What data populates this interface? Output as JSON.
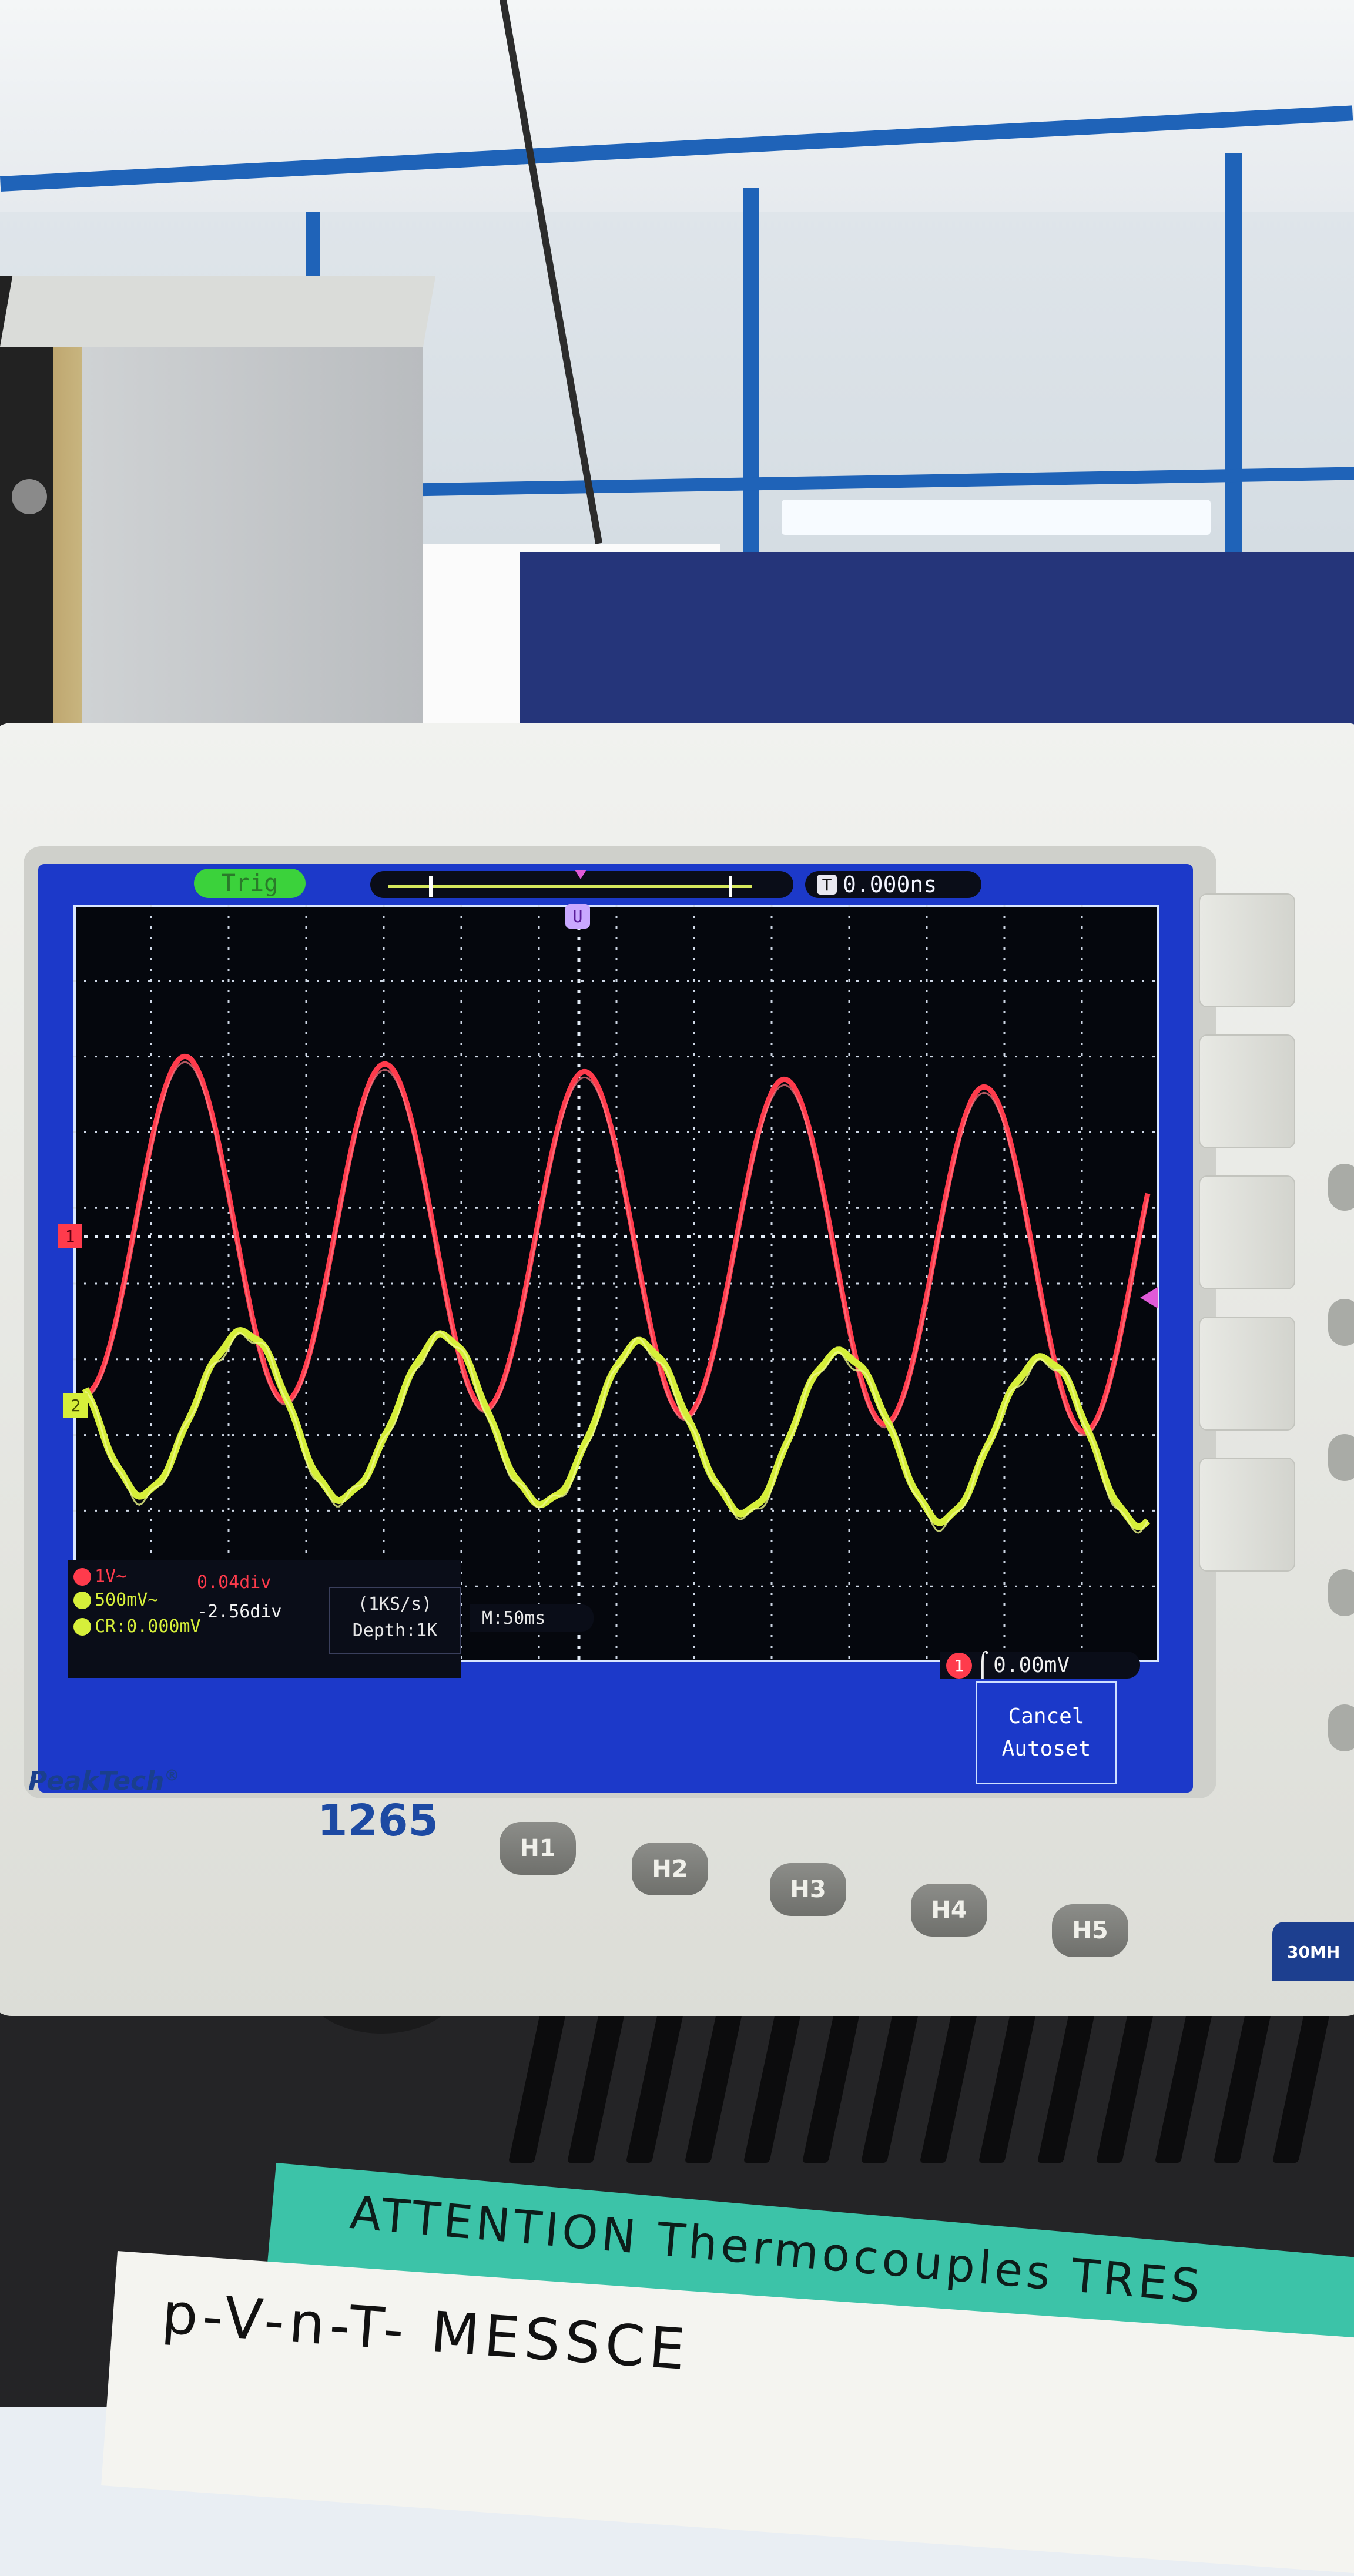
{
  "scope": {
    "brand": "PeakTech",
    "brand_mark": "®",
    "model": "1265",
    "spec_badge": "30MH",
    "trigger_status": "Trig",
    "trigger_time": "0.000ns",
    "trigger_time_icon": "T",
    "ch1_marker": "1",
    "ch2_marker": "2",
    "trigger_marker": "U",
    "ch1_scale": "1V~",
    "ch1_offset": "0.04div",
    "ch2_scale": "500mV~",
    "ch2_offset": "-2.56div",
    "cursor_readout": "CR:0.000mV",
    "sample_rate": "(1KS/s)",
    "depth": "Depth:1K",
    "timebase": "M:50ms",
    "trigger_level": "0.00mV",
    "trigger_level_icon": "1",
    "softkey_line1": "Cancel",
    "softkey_line2": "Autoset",
    "buttons": [
      "H1",
      "H2",
      "H3",
      "H4",
      "H5"
    ]
  },
  "label": {
    "warning": "ATTENTION Thermocouples TRES",
    "device": "p-V-n-T- MESSCE"
  },
  "colors": {
    "screen_blue": "#1c39c9",
    "ch1": "#ff3b4c",
    "ch2": "#d6ef3a",
    "grid": "#cfd8e6"
  }
}
